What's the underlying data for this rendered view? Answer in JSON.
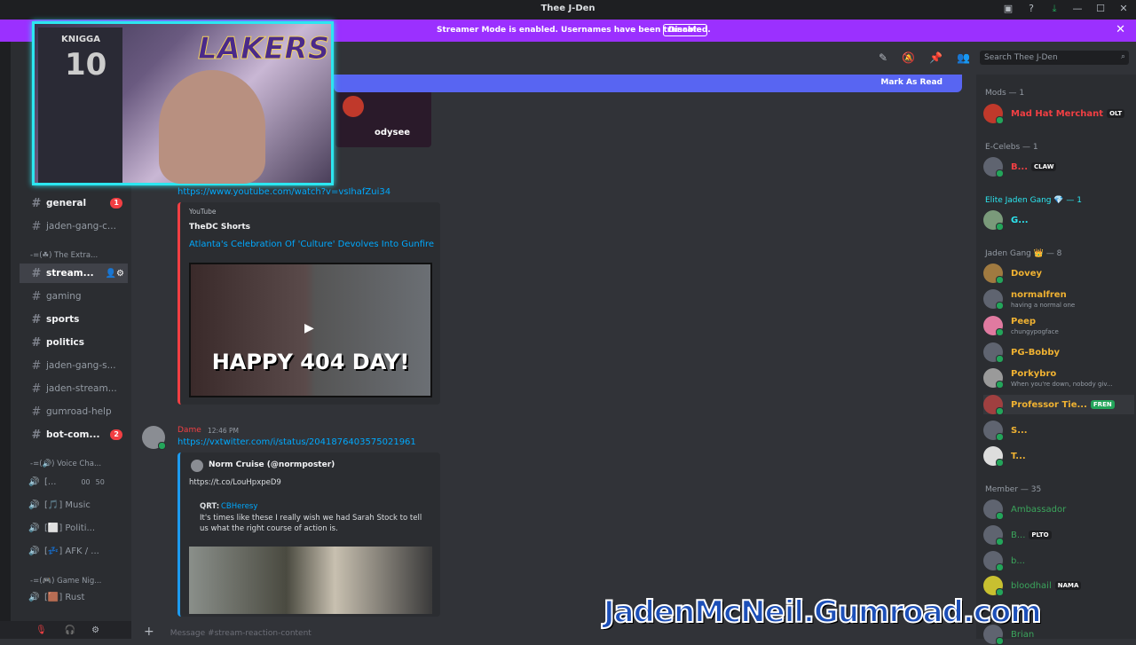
{
  "window": {
    "title": "Thee J-Den"
  },
  "banner": {
    "message": "Streamer Mode is enabled. Usernames have been truncated.",
    "disable_label": "Disable"
  },
  "newbar": {
    "mark_read": "Mark As Read"
  },
  "search": {
    "placeholder": "Search Thee J-Den"
  },
  "channels": {
    "general": "general",
    "general_badge": "1",
    "jaden_gang_c": "jaden-gang-c...",
    "cat_extra": "-=(☘) The Extra...",
    "stream": "stream...",
    "gaming": "gaming",
    "sports": "sports",
    "politics": "politics",
    "jaden_gang_s": "jaden-gang-s...",
    "jaden_stream": "jaden-stream...",
    "gumroad_help": "gumroad-help",
    "bot_com": "bot-com...",
    "bot_badge": "2",
    "cat_voice": "-=(🔊) Voice Cha...",
    "voice1": "[...",
    "voice1_count1": "00",
    "voice1_count2": "50",
    "voice2": "[🎵] Music",
    "voice3": "[⬜] Politi...",
    "voice4": "[💤] AFK / ...",
    "cat_game": "-=(🎮) Game Nig...",
    "voice5": "[🟫] Rust"
  },
  "messages": {
    "link1": "https://www.youtube.com/watch?v=vsIhafZui34",
    "yt_provider": "YouTube",
    "yt_author": "TheDC Shorts",
    "yt_title": "Atlanta's Celebration Of 'Culture' Devolves Into Gunfire",
    "yt_thumb_text": "HAPPY 404 DAY!",
    "odysee": "odysee",
    "author2": "Dame",
    "time2": "12:46 PM",
    "link2": "https://vxtwitter.com/i/status/2041876403575021961",
    "tw_author": "Norm Cruise (@normposter)",
    "tw_link": "https://t.co/LouHpxpeD9",
    "qrt_label": "QRT:",
    "qrt_handle": "CBHeresy",
    "qrt_text": "It's times like these I really wish we had Sarah Stock to tell us what the right course of action is.",
    "input_placeholder": "Message #stream-reaction-content"
  },
  "members": {
    "mods_header": "Mods — 1",
    "mod1": "Mad Hat Merchant",
    "mod1_tag": "OLT",
    "ecelebs_header": "E-Celebs — 1",
    "ec1": "B...",
    "ec1_tag": "CLAW",
    "elite_header": "Elite Jaden Gang 💎 — 1",
    "el1": "G...",
    "gang_header": "Jaden Gang 👑 — 8",
    "g1": "Dovey",
    "g2": "normalfren",
    "g2_sub": "having a normal one",
    "g3": "Peep",
    "g3_sub": "chungypogface",
    "g4": "PG-Bobby",
    "g5": "Porkybro",
    "g5_sub": "When you're down, nobody giv...",
    "g6": "Professor Tie...",
    "g6_tag": "FREN",
    "g7": "S...",
    "g8": "T...",
    "member_header": "Member — 35",
    "m1": "Ambassador",
    "m2": "B...",
    "m2_tag": "PLTO",
    "m3": "b...",
    "m4": "bloodhail",
    "m4_tag": "NAMA",
    "m5": "Brian"
  },
  "overlay": {
    "watermark": "JadenMcNeil.Gumroad.com",
    "jersey_name": "KNIGGA",
    "jersey_num": "10",
    "lakers": "LAKERS"
  }
}
